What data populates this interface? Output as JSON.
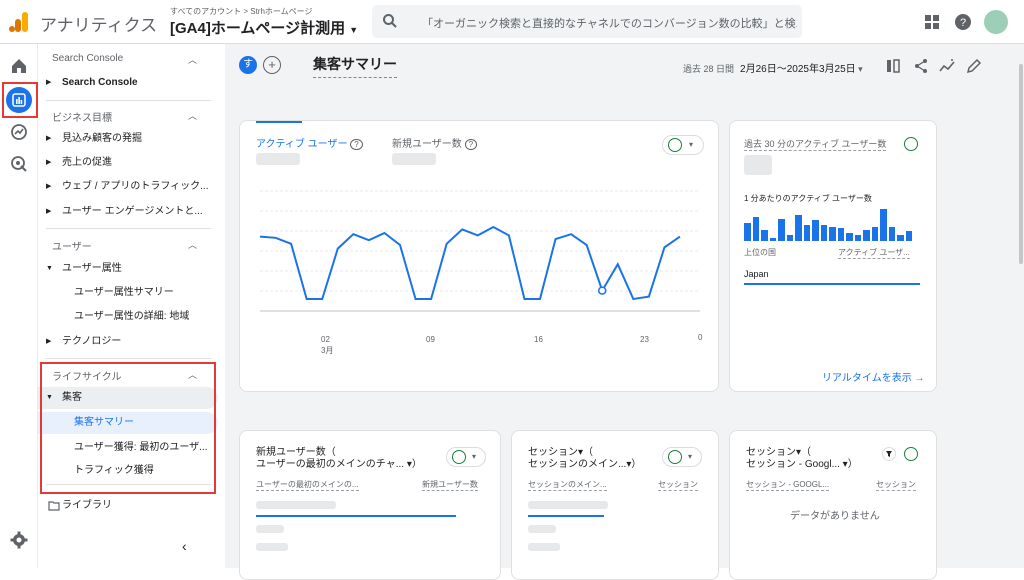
{
  "topbar": {
    "app_name": "アナリティクス",
    "breadcrumb": "すべてのアカウント > Strhホームページ",
    "property": "[GA4]ホームページ計測用",
    "search_placeholder": "「オーガニック検索と直接的なチャネルでのコンバージョン数の比較」と検..."
  },
  "nav": {
    "section_search_console": "Search Console",
    "item_search_console": "Search Console",
    "section_business": "ビジネス目標",
    "business_items": [
      "見込み顧客の発掘",
      "売上の促進",
      "ウェブ / アプリのトラフィック...",
      "ユーザー エンゲージメントと..."
    ],
    "section_user": "ユーザー",
    "user_attr": "ユーザー属性",
    "user_attr_summary": "ユーザー属性サマリー",
    "user_attr_detail": "ユーザー属性の詳細: 地域",
    "technology": "テクノロジー",
    "section_lifecycle": "ライフサイクル",
    "acquisition": "集客",
    "acq_summary": "集客サマリー",
    "acq_user": "ユーザー獲得: 最初のユーザ...",
    "acq_traffic": "トラフィック獲得",
    "library": "ライブラリ"
  },
  "header": {
    "chip": "す",
    "plus": "+",
    "title": "集客サマリー",
    "date_prefix": "過去 28 日間",
    "date_range": "2月26日～2025年3月25日"
  },
  "card_main": {
    "tab_active": "アクティブ ユーザー",
    "tab_new": "新規ユーザー数",
    "help": "?",
    "x_ticks": [
      "02",
      "09",
      "16",
      "23"
    ],
    "x_month": "3月",
    "y_zero": "0"
  },
  "chart_data": {
    "type": "line",
    "title": "",
    "series": [
      {
        "values": [
          62,
          61,
          56,
          10,
          10,
          52,
          64,
          59,
          65,
          55,
          10,
          10,
          56,
          68,
          63,
          70,
          63,
          10,
          10,
          60,
          64,
          55,
          17,
          39,
          10,
          12,
          53,
          62
        ]
      }
    ],
    "ylim": [
      0,
      100
    ]
  },
  "card_realtime": {
    "title_a": "過去 30 分のアクティブ ユーザー数",
    "per_minute": "1 分あたりのアクティブ ユーザー数",
    "bars": [
      0.55,
      0.75,
      0.35,
      0.1,
      0.7,
      0.2,
      0.8,
      0.5,
      0.65,
      0.5,
      0.45,
      0.4,
      0.25,
      0.2,
      0.35,
      0.45,
      1.0,
      0.45,
      0.2,
      0.3
    ],
    "col_country": "上位の国",
    "col_users": "アクティブ ユーザ...",
    "country": "Japan",
    "link": "リアルタイムを表示 →"
  },
  "card_new_users": {
    "title1": "新規ユーザー数（",
    "title2": "ユーザーの最初のメインのチャ... ▾）",
    "col1": "ユーザーの最初のメインの...",
    "col2": "新規ユーザー数"
  },
  "card_sessions": {
    "title1": "セッション▾（",
    "title2": "セッションのメイン...▾）",
    "col1": "セッションのメイン...",
    "col2": "セッション"
  },
  "card_sessions2": {
    "title1": "セッション▾（",
    "title2": "セッション - Googl... ▾）",
    "col1": "セッション - GOOGL...",
    "col2": "セッション",
    "empty": "データがありません"
  },
  "colors": {
    "accent": "#1a73e8",
    "highlight": "#e53935",
    "success": "#188038"
  }
}
